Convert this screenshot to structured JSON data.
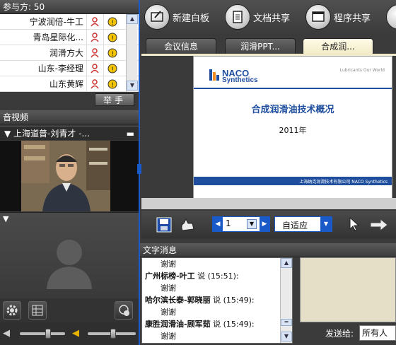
{
  "participants": {
    "header": "参与方: 50",
    "rows": [
      {
        "name": "宁波润倍-牛工"
      },
      {
        "name": "青岛星际化..."
      },
      {
        "name": "润滑方大"
      },
      {
        "name": "山东-李经理"
      },
      {
        "name": "山东黄辉"
      }
    ],
    "raise_hand": "举手"
  },
  "av": {
    "header": "音视频",
    "video_title": "上海道普-刘青才 -..."
  },
  "toolbar": {
    "whiteboard": "新建白板",
    "doc_share": "文档共享",
    "app_share": "程序共享"
  },
  "tabs": [
    {
      "label": "会议信息"
    },
    {
      "label": "润滑PPT..."
    },
    {
      "label": "合成润..."
    }
  ],
  "slide": {
    "logo_top": "NACO",
    "logo_bottom": "Synthetics",
    "tagline": "Lubricants Our World",
    "title": "合成润滑油技术概况",
    "year": "2011年",
    "footer": "上海纳克润滑技术有限公司   NACO Synthetics"
  },
  "controls": {
    "page_value": "1",
    "zoom_label": "自适应"
  },
  "chat": {
    "header": "文字消息",
    "lines": [
      {
        "type": "msg",
        "text": "谢谢"
      },
      {
        "type": "head",
        "name": "广州标榜-叶工",
        "suffix": " 说 (15:51):"
      },
      {
        "type": "msg",
        "text": "谢谢"
      },
      {
        "type": "head",
        "name": "哈尔滨长泰-郭晓丽",
        "suffix": " 说 (15:49):"
      },
      {
        "type": "msg",
        "text": "谢谢"
      },
      {
        "type": "head",
        "name": "康胜润滑油-顾军茹",
        "suffix": " 说 (15:49):"
      },
      {
        "type": "msg",
        "text": "谢谢"
      }
    ],
    "send_to_label": "发送给:",
    "send_to_value": "所有人"
  }
}
